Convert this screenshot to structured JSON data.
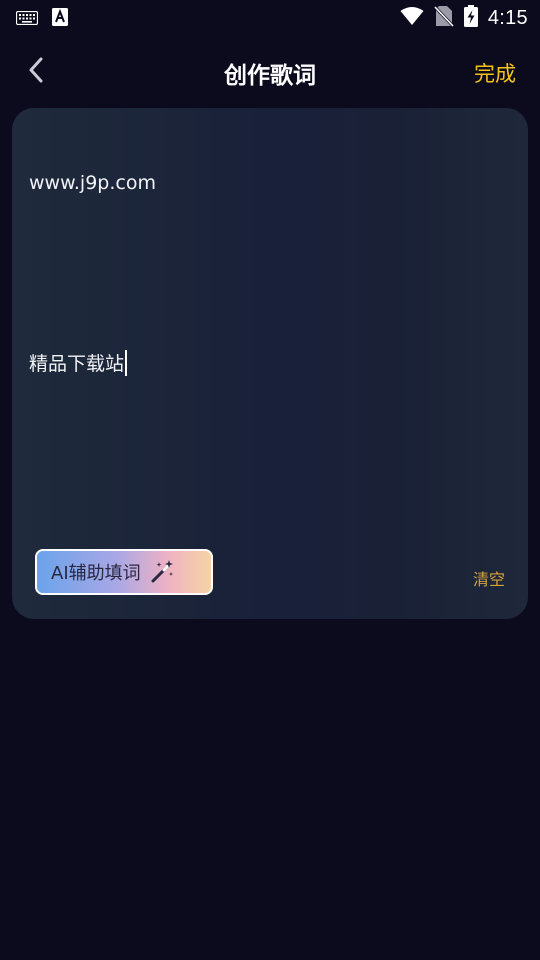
{
  "status_bar": {
    "time": "4:15",
    "left_icons": [
      "keyboard-icon",
      "font-a-icon"
    ],
    "right_icons": [
      "wifi-icon",
      "no-sim-icon",
      "battery-charging-icon"
    ]
  },
  "header": {
    "title": "创作歌词",
    "done_label": "完成",
    "back_icon": "chevron-left-icon"
  },
  "editor": {
    "lines": [
      "www.j9p.com",
      "",
      "精品下载站"
    ],
    "ai_button_label": "AI辅助填词",
    "ai_button_icon": "magic-wand-icon",
    "clear_label": "清空"
  },
  "colors": {
    "background": "#0c0b1e",
    "accent": "#f7c21a",
    "clear_text": "#d9a338"
  }
}
